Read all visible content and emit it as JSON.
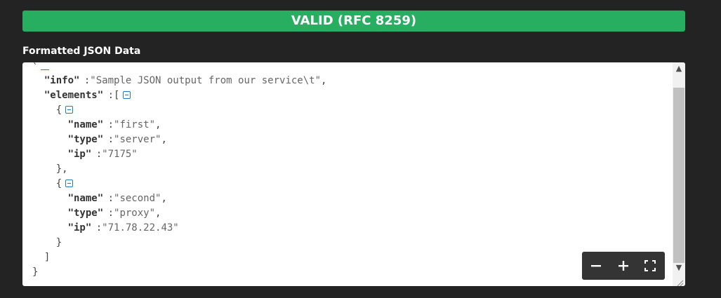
{
  "status": {
    "text": "VALID (RFC 8259)",
    "color": "#27ae60"
  },
  "section_label": "Formatted JSON Data",
  "json_view": {
    "lines": [
      {
        "indent": 2,
        "key": "info",
        "value": "\"Sample JSON output from our service\\t\"",
        "suffix": ","
      },
      {
        "indent": 2,
        "key": "elements",
        "open": "[",
        "fold": true
      },
      {
        "indent": 4,
        "text": "{",
        "fold": true
      },
      {
        "indent": 6,
        "key": "name",
        "value": "\"first\"",
        "suffix": ","
      },
      {
        "indent": 6,
        "key": "type",
        "value": "\"server\"",
        "suffix": ","
      },
      {
        "indent": 6,
        "key": "ip",
        "value": "\"7175\"",
        "suffix": ""
      },
      {
        "indent": 4,
        "text": "},"
      },
      {
        "indent": 4,
        "text": "{",
        "fold": true
      },
      {
        "indent": 6,
        "key": "name",
        "value": "\"second\"",
        "suffix": ","
      },
      {
        "indent": 6,
        "key": "type",
        "value": "\"proxy\"",
        "suffix": ","
      },
      {
        "indent": 6,
        "key": "ip",
        "value": "\"71.78.22.43\"",
        "suffix": ""
      },
      {
        "indent": 4,
        "text": "}"
      },
      {
        "indent": 2,
        "text": "]"
      },
      {
        "indent": 0,
        "text": "}"
      }
    ]
  },
  "toolbar": {
    "zoom_out_icon": "minus-icon",
    "zoom_in_icon": "plus-icon",
    "fullscreen_icon": "fullscreen-icon"
  }
}
